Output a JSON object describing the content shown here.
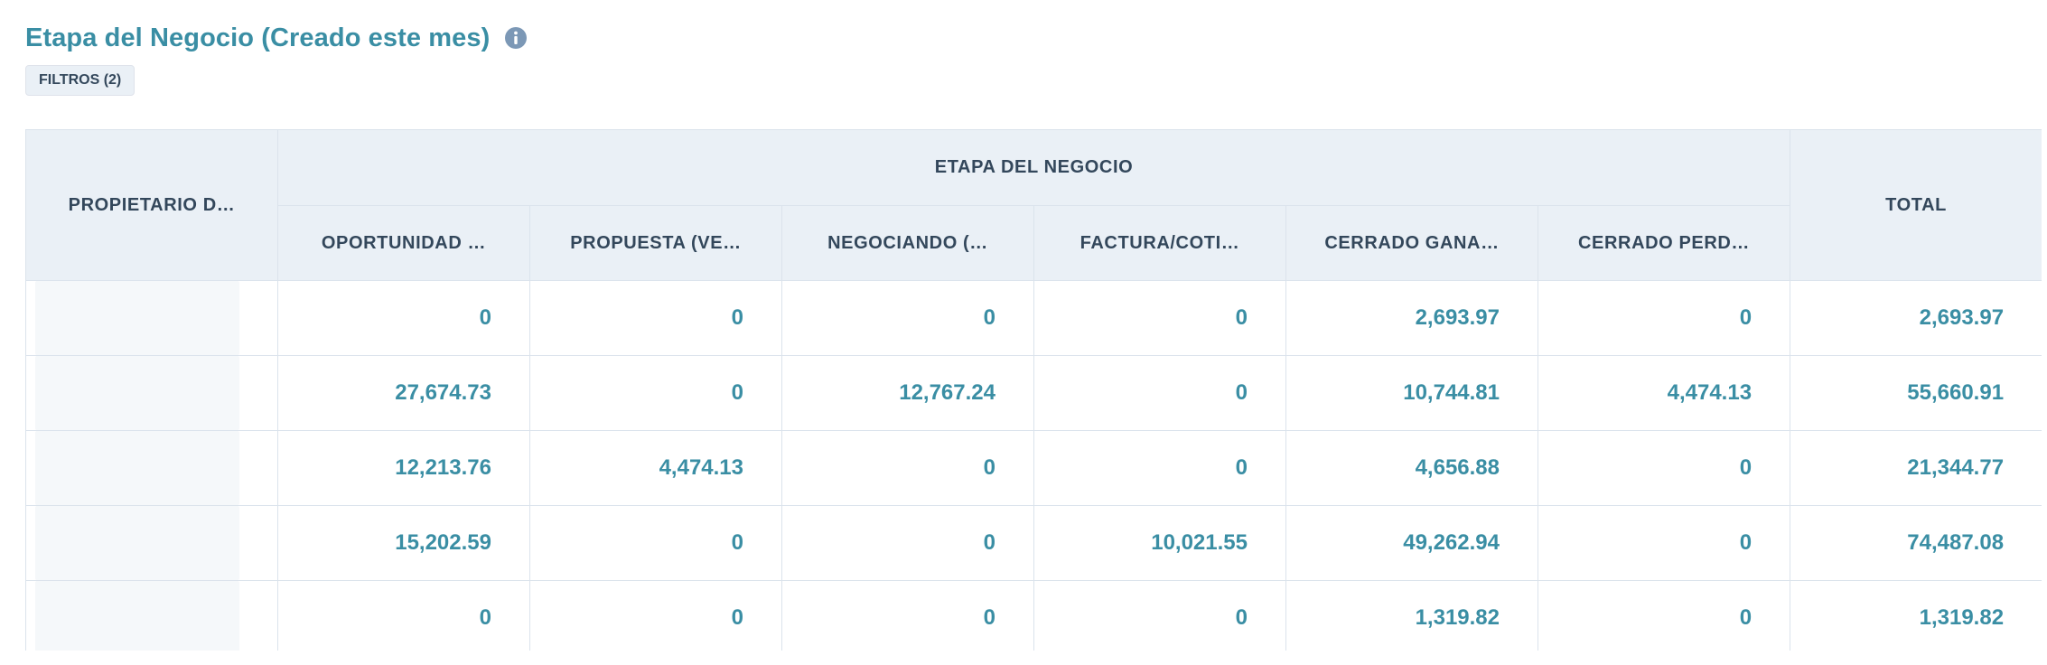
{
  "report": {
    "title": "Etapa del Negocio (Creado este mes)",
    "filters_label": "FILTROS (2)"
  },
  "icons": {
    "info": "info-circle-icon"
  },
  "colors": {
    "accent": "#3a8ea4",
    "header_bg": "#eaf0f6",
    "header_text": "#33475b",
    "border": "#dbe3ec"
  },
  "table": {
    "owner_header": "PROPIETARIO D…",
    "group_header": "ETAPA DEL NEGOCIO",
    "total_header": "TOTAL",
    "stage_headers": [
      "OPORTUNIDAD …",
      "PROPUESTA (VE…",
      "NEGOCIANDO (…",
      "FACTURA/COTI…",
      "CERRADO GANA…",
      "CERRADO PERD…"
    ],
    "rows": [
      {
        "values": [
          "0",
          "0",
          "0",
          "0",
          "2,693.97",
          "0"
        ],
        "total": "2,693.97"
      },
      {
        "values": [
          "27,674.73",
          "0",
          "12,767.24",
          "0",
          "10,744.81",
          "4,474.13"
        ],
        "total": "55,660.91"
      },
      {
        "values": [
          "12,213.76",
          "4,474.13",
          "0",
          "0",
          "4,656.88",
          "0"
        ],
        "total": "21,344.77"
      },
      {
        "values": [
          "15,202.59",
          "0",
          "0",
          "10,021.55",
          "49,262.94",
          "0"
        ],
        "total": "74,487.08"
      },
      {
        "values": [
          "0",
          "0",
          "0",
          "0",
          "1,319.82",
          "0"
        ],
        "total": "1,319.82"
      }
    ]
  }
}
